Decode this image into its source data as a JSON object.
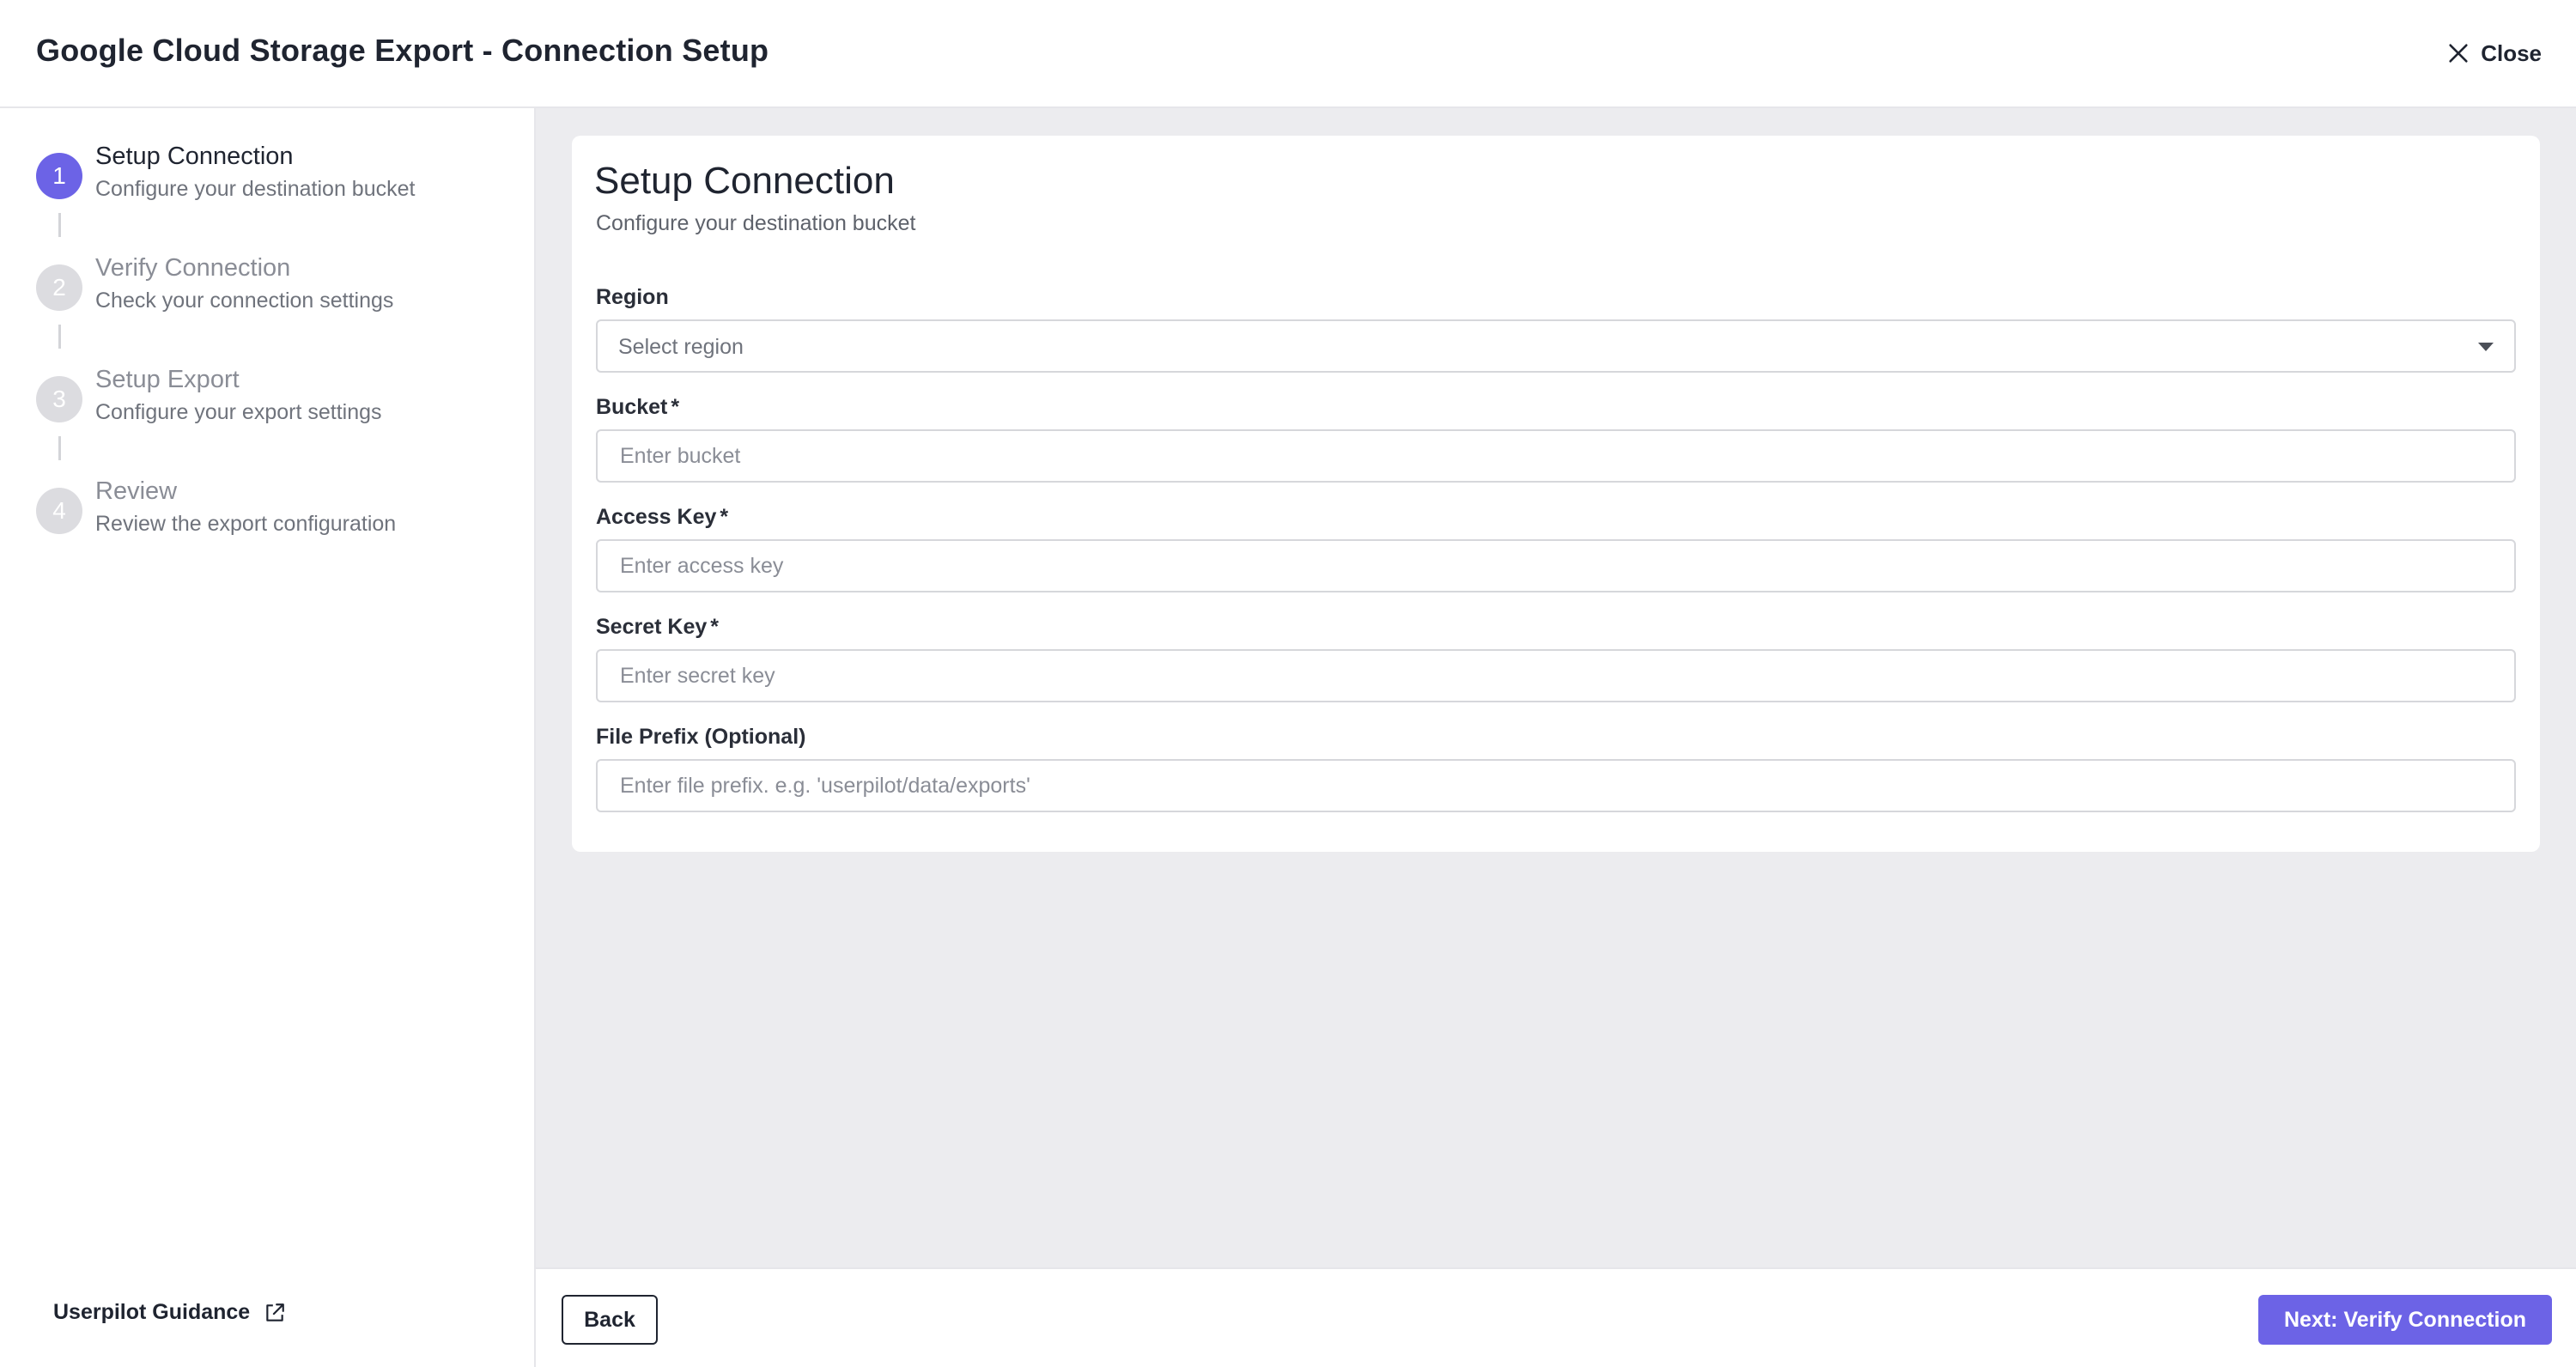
{
  "header": {
    "title": "Google Cloud Storage Export - Connection Setup",
    "close_label": "Close",
    "close_icon": "close-icon"
  },
  "sidebar": {
    "steps": [
      {
        "number": "1",
        "title": "Setup Connection",
        "subtitle": "Configure your destination bucket",
        "active": true
      },
      {
        "number": "2",
        "title": "Verify Connection",
        "subtitle": "Check your connection settings",
        "active": false
      },
      {
        "number": "3",
        "title": "Setup Export",
        "subtitle": "Configure your export settings",
        "active": false
      },
      {
        "number": "4",
        "title": "Review",
        "subtitle": "Review the export configuration",
        "active": false
      }
    ],
    "guidance_label": "Userpilot Guidance",
    "guidance_icon": "external-link-icon"
  },
  "form": {
    "title": "Setup Connection",
    "subtitle": "Configure your destination bucket",
    "region": {
      "label": "Region",
      "placeholder": "Select region"
    },
    "bucket": {
      "label": "Bucket",
      "required_mark": "*",
      "placeholder": "Enter bucket"
    },
    "access_key": {
      "label": "Access Key",
      "required_mark": "*",
      "placeholder": "Enter access key"
    },
    "secret_key": {
      "label": "Secret Key",
      "required_mark": "*",
      "placeholder": "Enter secret key"
    },
    "file_prefix": {
      "label": "File Prefix (Optional)",
      "placeholder": "Enter file prefix. e.g. 'userpilot/data/exports'"
    }
  },
  "footer": {
    "back_label": "Back",
    "next_label": "Next: Verify Connection"
  },
  "colors": {
    "accent": "#6c63e6",
    "inactive_step": "#dcdce0",
    "main_background": "#ececef"
  }
}
